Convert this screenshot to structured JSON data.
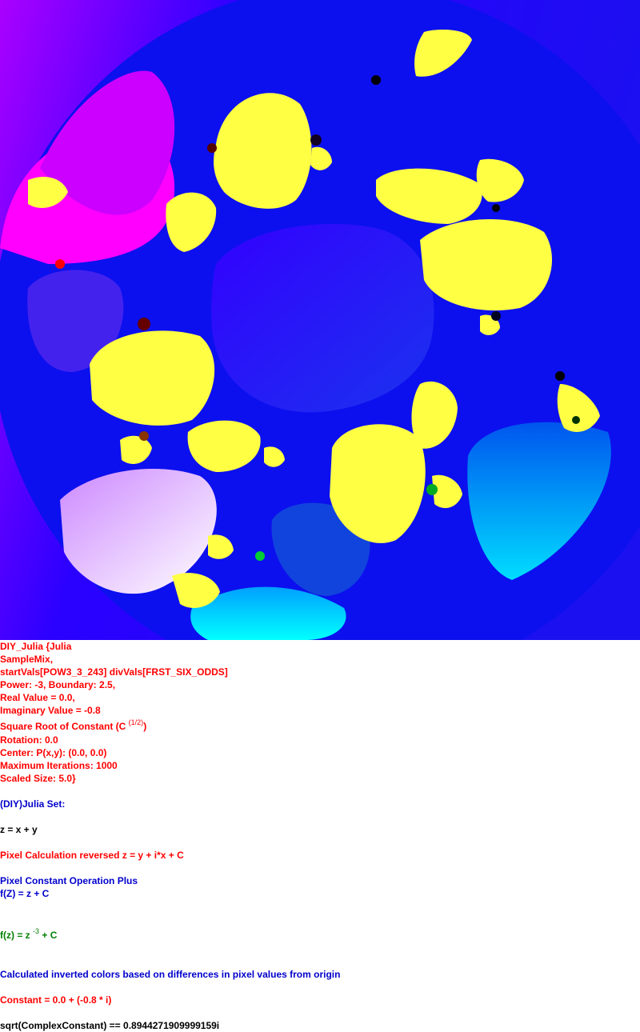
{
  "params": {
    "line1": "DIY_Julia {Julia",
    "line2": "SampleMix,",
    "line3": "startVals[POW3_3_243] divVals[FRST_SIX_ODDS]",
    "line4": "Power: -3, Boundary: 2.5,",
    "line5": "Real Value = 0.0,",
    "line6": "Imaginary Value = -0.8",
    "sqrt_label": "Square Root of Constant (C",
    "sqrt_exp": "(1/2)",
    "sqrt_close": ")",
    "rotation": "Rotation: 0.0",
    "center": "Center: P(x,y): (0.0, 0.0)",
    "max_iter": "Maximum Iterations: 1000",
    "scaled": "Scaled Size: 5.0}"
  },
  "formula": {
    "title": "(DIY)Julia Set:",
    "z_def": "z = x + y",
    "pixel_calc": "Pixel Calculation reversed z = y + i*x + C",
    "const_op": "Pixel Constant Operation Plus",
    "fz_plus": "f(Z) = z + C",
    "fz_prefix": "f(z) = z",
    "fz_exp": "-3",
    "fz_suffix": " + C",
    "colors": "Calculated inverted colors based on differences in pixel values from origin",
    "constant": "Constant = 0.0 + (-0.8 * i)",
    "sqrt_value": "sqrt(ComplexConstant) == 0.8944271909999159i"
  },
  "colors": {
    "deep_blue": "#0000ee",
    "yellow": "#ffff44",
    "magenta": "#ff00ff",
    "cyan": "#00ffff"
  }
}
